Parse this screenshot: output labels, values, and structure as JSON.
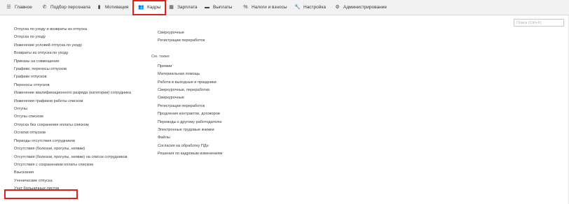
{
  "nav": {
    "items": [
      {
        "label": "Главное",
        "icon": "hamburger-icon"
      },
      {
        "label": "Подбор персонала",
        "icon": "phone-icon"
      },
      {
        "label": "Мотивация",
        "icon": "bar-chart-icon"
      },
      {
        "label": "Кадры",
        "icon": "users-icon"
      },
      {
        "label": "Зарплата",
        "icon": "calculator-icon"
      },
      {
        "label": "Выплаты",
        "icon": "wallet-icon"
      },
      {
        "label": "Налоги и взносы",
        "icon": "percent-icon"
      },
      {
        "label": "Настройка",
        "icon": "wrench-icon"
      },
      {
        "label": "Администрирование",
        "icon": "gear-icon"
      }
    ],
    "active": "Кадры"
  },
  "search": {
    "placeholder": "Поиск (Ctrl+F)"
  },
  "left_links": [
    "Отпуска по уходу и возвраты из отпуска",
    "Отпуска по уходу",
    "Изменение условий отпуска по уходу",
    "Возвраты из отпуска по уходу",
    "Приказы на совмещение",
    "Графики, переносы отпусков",
    "Графики отпусков",
    "Переносы отпусков",
    "Изменение квалификационного разряда (категории) сотрудника",
    "Изменения графиков работы списком",
    "Отгулы",
    "Отгулы списком",
    "Отпуска без сохранения оплаты списком",
    "Остатки отпусков",
    "Периоды отсутствия сотрудников",
    "Отсутствия (болезни, прогулы, неявки)",
    "Отсутствия (болезни, прогулы, неявки) на список сотрудников",
    "Отсутствия с сохранением оплаты списком",
    "Взыскания",
    "Ученические отпуска",
    "Учет больничных листов"
  ],
  "right_top_links": [
    "Сверхурочные",
    "Регистрации переработок"
  ],
  "see_also": {
    "heading": "См. также",
    "links": [
      "Премии",
      "Материальная помощь",
      "Работа в выходные и праздники",
      "Сверхурочные, переработки",
      "Сверхурочные",
      "Регистрации переработок",
      "Продления контрактов, договоров",
      "Переводы к другому работодателю",
      "Электронные трудовые книжки",
      "Файлы",
      "Согласия на обработку ПДн",
      "Решения по кадровым изменениям"
    ]
  },
  "colors": {
    "highlight": "#e0201b",
    "topbar": "#f2f2f2"
  }
}
